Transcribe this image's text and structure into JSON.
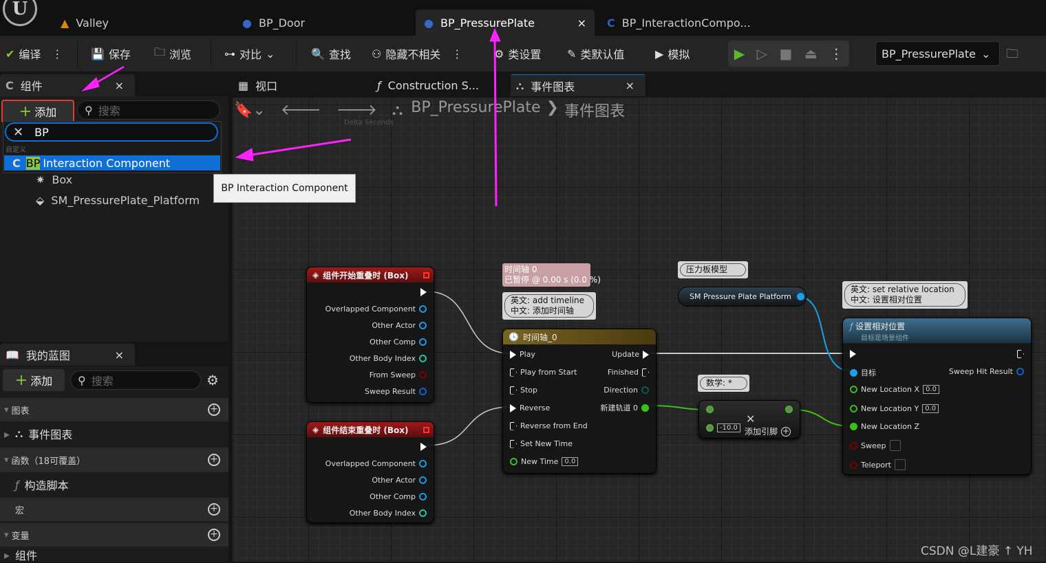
{
  "tabs": [
    {
      "label": "Valley"
    },
    {
      "label": "BP_Door"
    },
    {
      "label": "BP_PressurePlate",
      "close": "×"
    },
    {
      "label": "BP_InteractionCompo..."
    }
  ],
  "toolbar": {
    "compile": "编译",
    "save": "保存",
    "browse": "浏览",
    "diff": "对比",
    "find": "查找",
    "hide_unrelated": "隐藏不相关",
    "class_settings": "类设置",
    "class_defaults": "类默认值",
    "simulate": "模拟",
    "debug_object": "BP_PressurePlate"
  },
  "components_panel": {
    "title": "组件",
    "close": "×",
    "add": "添加",
    "search_placeholder": "搜索",
    "filter_value": "BP",
    "category": "自定义",
    "highlighted_match": "BP",
    "selected_rest": "Interaction Component",
    "items": [
      "Box",
      "SM_PressurePlate_Platform"
    ]
  },
  "tooltip": "BP Interaction Component",
  "editor_tabs": {
    "viewport": "视口",
    "construction": "Construction S...",
    "event_graph": "事件图表",
    "close": "×"
  },
  "breadcrumb": {
    "blueprint": "BP_PressurePlate",
    "separator": "❯",
    "graph": "事件图表",
    "ghost": "Delta Seconds"
  },
  "my_blueprint": {
    "title": "我的蓝图",
    "close": "×",
    "add": "添加",
    "search_placeholder": "搜索",
    "sections": [
      {
        "label": "图表",
        "item": "事件图表"
      },
      {
        "label": "函数（18可覆盖）",
        "item": "构造脚本"
      },
      {
        "label": "宏"
      },
      {
        "label": "变量",
        "item": "组件"
      }
    ]
  },
  "nodes": {
    "begin_overlap": {
      "title": "组件开始重叠时 (Box)",
      "pins": [
        "Overlapped Component",
        "Other Actor",
        "Other Comp",
        "Other Body Index",
        "From Sweep",
        "Sweep Result"
      ]
    },
    "end_overlap": {
      "title": "组件结束重叠时 (Box)",
      "pins": [
        "Overlapped Component",
        "Other Actor",
        "Other Comp",
        "Other Body Index"
      ]
    },
    "timeline_status": {
      "line1": "时间轴 0",
      "line2": "已暂停 @ 0.00 s (0.0 %)"
    },
    "timeline_comment": {
      "line1": "英文: add timeline",
      "line2": "中文: 添加时间轴"
    },
    "timeline": {
      "title": "时间轴_0",
      "inputs": [
        "Play",
        "Play from Start",
        "Stop",
        "Reverse",
        "Reverse from End",
        "Set New Time",
        "New Time"
      ],
      "new_time": "0.0",
      "outputs": [
        "Update",
        "Finished",
        "Direction",
        "新建轨道 0"
      ]
    },
    "sm_comment": "压力板模型",
    "sm_node": "SM Pressure Plate Platform",
    "multiply_comment": "数学: *",
    "multiply": {
      "b": "-10.0",
      "add_pin": "添加引脚"
    },
    "set_comment": {
      "line1": "英文: set relative location",
      "line2": "中文: 设置相对位置"
    },
    "set_node": {
      "title": "设置相对位置",
      "subtitle": "目标是场景组件",
      "target": "目标",
      "hit": "Sweep Hit Result",
      "x": "New Location X",
      "xv": "0.0",
      "y": "New Location Y",
      "yv": "0.0",
      "z": "New Location Z",
      "sweep": "Sweep",
      "teleport": "Teleport"
    }
  },
  "watermark": "CSDN @L建豪 ↑ YH",
  "colors": {
    "accent_selection": "#0f6fd6",
    "annotation": "#ff22ff",
    "highlight_box": "#e53935",
    "exec_wire": "#dddddd",
    "object_wire": "#1aa0e8",
    "float_wire": "#3cbf1a"
  }
}
